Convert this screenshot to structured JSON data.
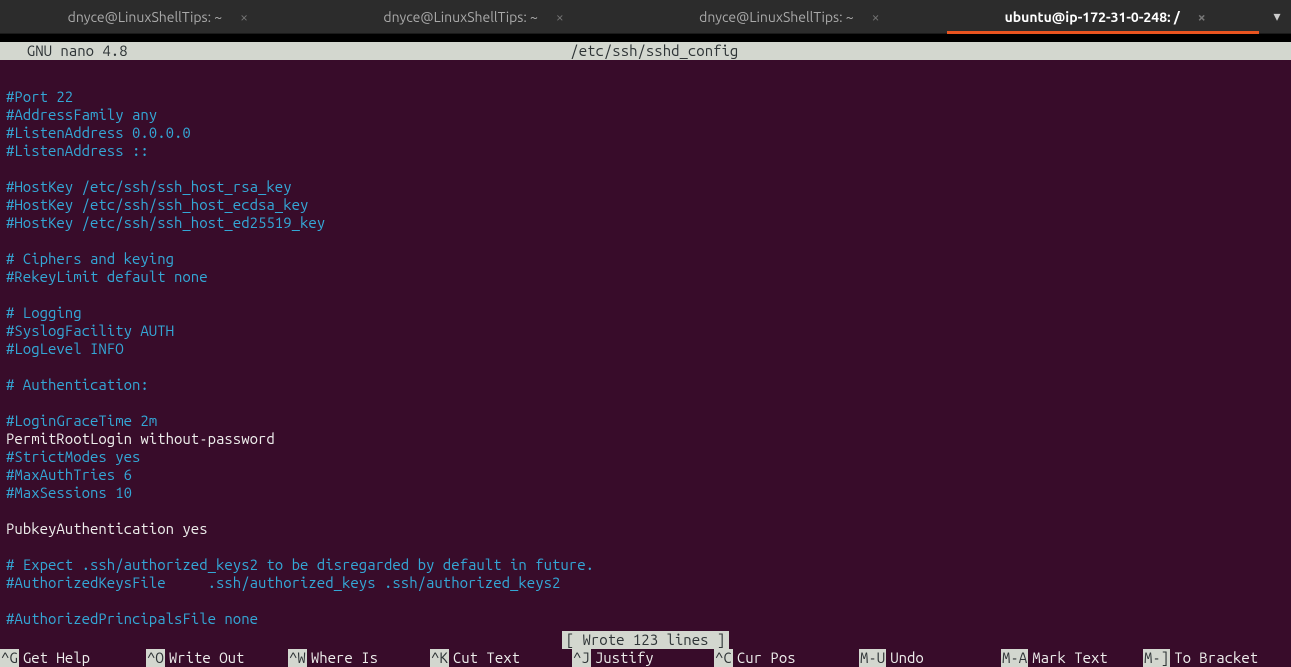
{
  "tabs": [
    {
      "title": "dnyce@LinuxShellTips: ~",
      "active": false
    },
    {
      "title": "dnyce@LinuxShellTips: ~",
      "active": false
    },
    {
      "title": "dnyce@LinuxShellTips: ~",
      "active": false
    },
    {
      "title": "ubuntu@ip-172-31-0-248: /",
      "active": true
    }
  ],
  "nano": {
    "version": "  GNU nano 4.8",
    "filename": "/etc/ssh/sshd_config",
    "status": "[ Wrote 123 lines ]"
  },
  "file_lines": [
    {
      "t": "",
      "c": "plain"
    },
    {
      "t": "#Port 22",
      "c": "comment"
    },
    {
      "t": "#AddressFamily any",
      "c": "comment"
    },
    {
      "t": "#ListenAddress 0.0.0.0",
      "c": "comment"
    },
    {
      "t": "#ListenAddress ::",
      "c": "comment"
    },
    {
      "t": "",
      "c": "plain"
    },
    {
      "t": "#HostKey /etc/ssh/ssh_host_rsa_key",
      "c": "comment"
    },
    {
      "t": "#HostKey /etc/ssh/ssh_host_ecdsa_key",
      "c": "comment"
    },
    {
      "t": "#HostKey /etc/ssh/ssh_host_ed25519_key",
      "c": "comment"
    },
    {
      "t": "",
      "c": "plain"
    },
    {
      "t": "# Ciphers and keying",
      "c": "comment"
    },
    {
      "t": "#RekeyLimit default none",
      "c": "comment"
    },
    {
      "t": "",
      "c": "plain"
    },
    {
      "t": "# Logging",
      "c": "comment"
    },
    {
      "t": "#SyslogFacility AUTH",
      "c": "comment"
    },
    {
      "t": "#LogLevel INFO",
      "c": "comment"
    },
    {
      "t": "",
      "c": "plain"
    },
    {
      "t": "# Authentication:",
      "c": "comment"
    },
    {
      "t": "",
      "c": "plain"
    },
    {
      "t": "#LoginGraceTime 2m",
      "c": "comment"
    },
    {
      "t": "PermitRootLogin without-password",
      "c": "plain"
    },
    {
      "t": "#StrictModes yes",
      "c": "comment"
    },
    {
      "t": "#MaxAuthTries 6",
      "c": "comment"
    },
    {
      "t": "#MaxSessions 10",
      "c": "comment"
    },
    {
      "t": "",
      "c": "plain"
    },
    {
      "t": "PubkeyAuthentication yes",
      "c": "plain"
    },
    {
      "t": "",
      "c": "plain"
    },
    {
      "t": "# Expect .ssh/authorized_keys2 to be disregarded by default in future.",
      "c": "comment"
    },
    {
      "t": "#AuthorizedKeysFile     .ssh/authorized_keys .ssh/authorized_keys2",
      "c": "comment"
    },
    {
      "t": "",
      "c": "plain"
    },
    {
      "t": "#AuthorizedPrincipalsFile none",
      "c": "comment"
    }
  ],
  "help": [
    {
      "key": "^G",
      "label": "Get Help"
    },
    {
      "key": "^O",
      "label": "Write Out"
    },
    {
      "key": "^W",
      "label": "Where Is"
    },
    {
      "key": "^K",
      "label": "Cut Text"
    },
    {
      "key": "^J",
      "label": "Justify"
    },
    {
      "key": "^C",
      "label": "Cur Pos"
    },
    {
      "key": "M-U",
      "label": "Undo"
    },
    {
      "key": "M-A",
      "label": "Mark Text"
    },
    {
      "key": "M-]",
      "label": "To Bracket"
    }
  ]
}
